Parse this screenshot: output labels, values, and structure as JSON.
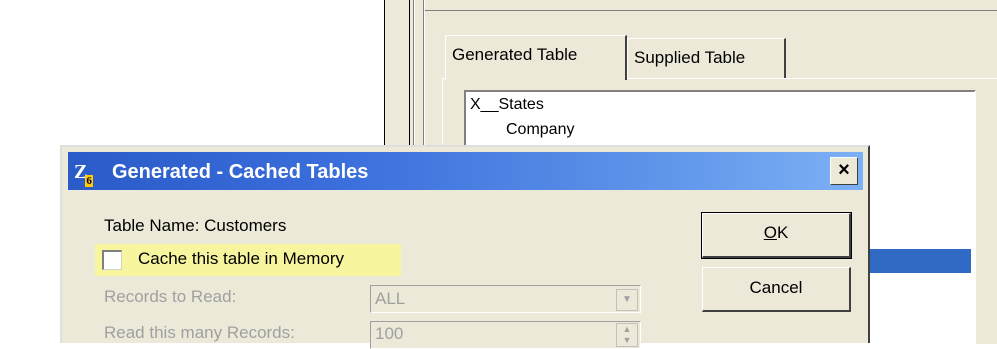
{
  "background_window": {
    "tabs": [
      {
        "label": "Generated Table",
        "active": true
      },
      {
        "label": "Supplied Table",
        "active": false
      }
    ],
    "list_items": [
      "X__States",
      "Company"
    ]
  },
  "dialog": {
    "app_icon_text": "Z",
    "app_icon_sub": "6",
    "title": "Generated - Cached Tables",
    "close_label": "×",
    "table_name_label": "Table Name: Customers",
    "cache_checkbox_label": "Cache this table in Memory",
    "cache_checked": false,
    "records_to_read_label": "Records to Read:",
    "records_to_read_value": "ALL",
    "read_many_label": "Read this many Records:",
    "read_many_value": "100",
    "ok_label": "OK",
    "ok_mnemonic": "O",
    "ok_rest": "K",
    "cancel_label": "Cancel"
  },
  "colors": {
    "titlebar": "#3b6fdc",
    "highlight": "#f7f59e",
    "selection": "#316ac5",
    "panel": "#ece9d8"
  }
}
